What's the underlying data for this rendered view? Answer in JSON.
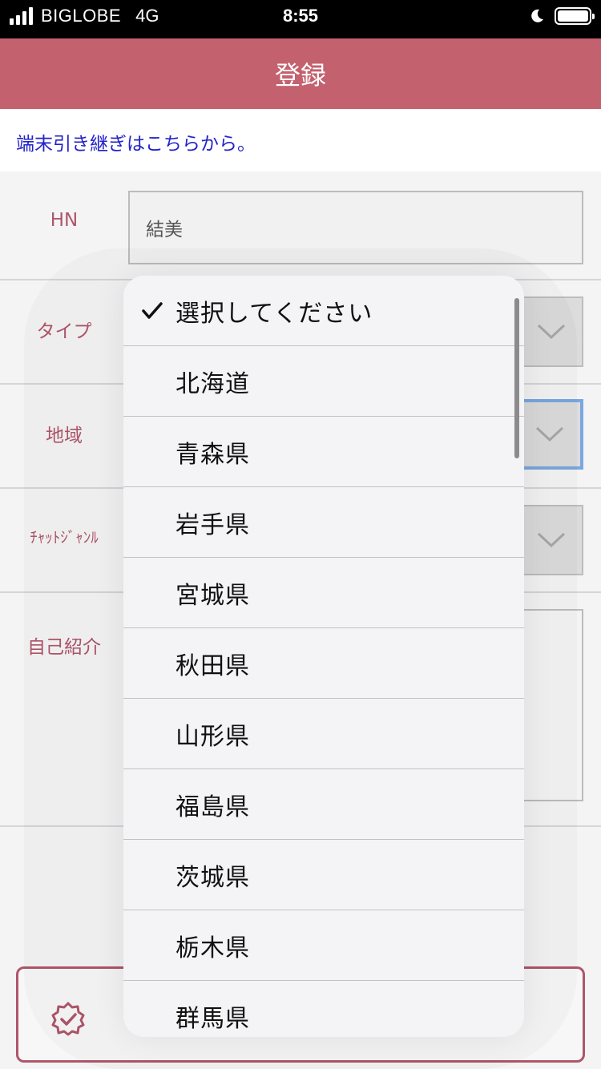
{
  "status_bar": {
    "carrier": "BIGLOBE",
    "network": "4G",
    "time": "8:55",
    "icons": [
      "signal-icon",
      "moon-icon",
      "battery-icon"
    ]
  },
  "header": {
    "title": "登録"
  },
  "transfer_link": "端末引き継ぎはこちらから。",
  "form": {
    "hn_label": "HN",
    "hn_value": "結美",
    "type_label": "タイプ",
    "region_label": "地域",
    "chat_genre_label": "ﾁｬｯﾄｼﾞｬﾝﾙ",
    "intro_label": "自己紹介"
  },
  "picker": {
    "options": [
      "選択してください",
      "北海道",
      "青森県",
      "岩手県",
      "宮城県",
      "秋田県",
      "山形県",
      "福島県",
      "茨城県",
      "栃木県",
      "群馬県"
    ],
    "selected": "選択してください"
  },
  "colors": {
    "header": "#c4616f",
    "label": "#b0566a",
    "link": "#2323c8",
    "focus": "#7aa7df"
  }
}
